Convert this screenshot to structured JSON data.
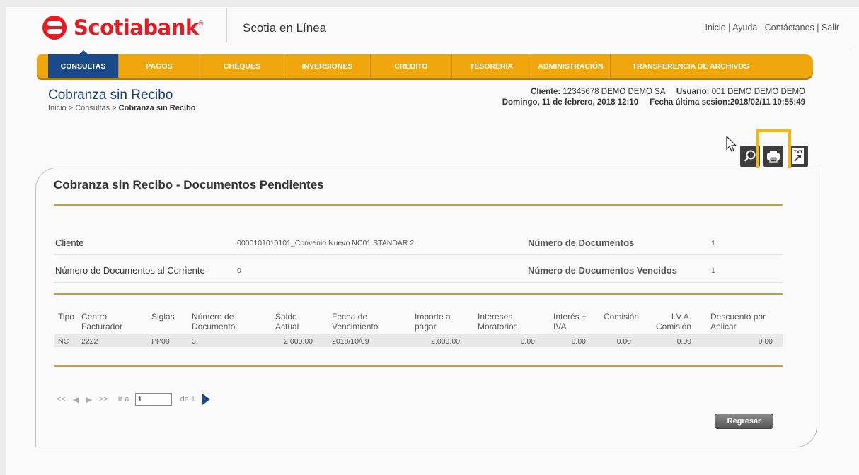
{
  "header": {
    "brand": "Scotiabank",
    "brand_reg": "®",
    "app_name": "Scotia en Línea",
    "links": [
      "Inicio",
      "Ayuda",
      "Contáctanos",
      "Salir"
    ]
  },
  "nav": {
    "items": [
      {
        "label": "CONSULTAS",
        "active": true
      },
      {
        "label": "PAGOS"
      },
      {
        "label": "CHEQUES"
      },
      {
        "label": "INVERSIONES"
      },
      {
        "label": "CREDITO"
      },
      {
        "label": "TESORERIA"
      },
      {
        "label": "ADMINISTRACIÓN"
      },
      {
        "label": "TRANSFERENCIA DE ARCHIVOS"
      }
    ]
  },
  "page": {
    "title": "Cobranza sin Recibo",
    "breadcrumb_prefix": "Inicio > Consultas > ",
    "breadcrumb_current": "Cobranza sin Recibo"
  },
  "session": {
    "cliente_label": "Cliente:",
    "cliente_value": "12345678 DEMO DEMO SA",
    "usuario_label": "Usuario:",
    "usuario_value": "001 DEMO DEMO DEMO",
    "date": "Domingo, 11 de febrero, 2018 12:10",
    "last_session_label": "Fecha última sesion:",
    "last_session_value": "2018/02/11 10:55:49"
  },
  "toolbar": {
    "txt_label": "TXT"
  },
  "panel": {
    "title": "Cobranza sin Recibo - Documentos Pendientes",
    "cliente_label": "Cliente",
    "cliente_value": "0000101010101_Convenio Nuevo NC01 STANDAR 2",
    "num_docs_label": "Número de Documentos",
    "num_docs_value": "1",
    "num_corriente_label": "Número de Documentos al Corriente",
    "num_corriente_value": "0",
    "num_vencidos_label": "Número de Documentos Vencidos",
    "num_vencidos_value": "1"
  },
  "table": {
    "headers": [
      "Tipo",
      "Centro\nFacturador",
      "Siglas",
      "Número de\nDocumento",
      "Saldo\nActual",
      "Fecha de\nVencimiento",
      "Importe a\npagar",
      "Intereses\nMoratorios",
      "Interés +\nIVA",
      "Comisión",
      "I.V.A.\nComisión",
      "Descuento por\nAplicar"
    ],
    "rows": [
      [
        "NC",
        "2222",
        "PP00",
        "3",
        "2,000.00",
        "2018/10/09",
        "2,000.00",
        "0.00",
        "0.00",
        "0.00",
        "0.00",
        "0.00"
      ]
    ]
  },
  "pager": {
    "ir_a": "Ir a",
    "page_value": "1",
    "de": "de 1"
  },
  "actions": {
    "back": "Regresar"
  },
  "colors": {
    "brand_red": "#e31b23",
    "nav_orange": "#f0a70d",
    "nav_active": "#1b4a8a",
    "gold_rule": "#c9a037",
    "highlight": "#f5b80a"
  }
}
